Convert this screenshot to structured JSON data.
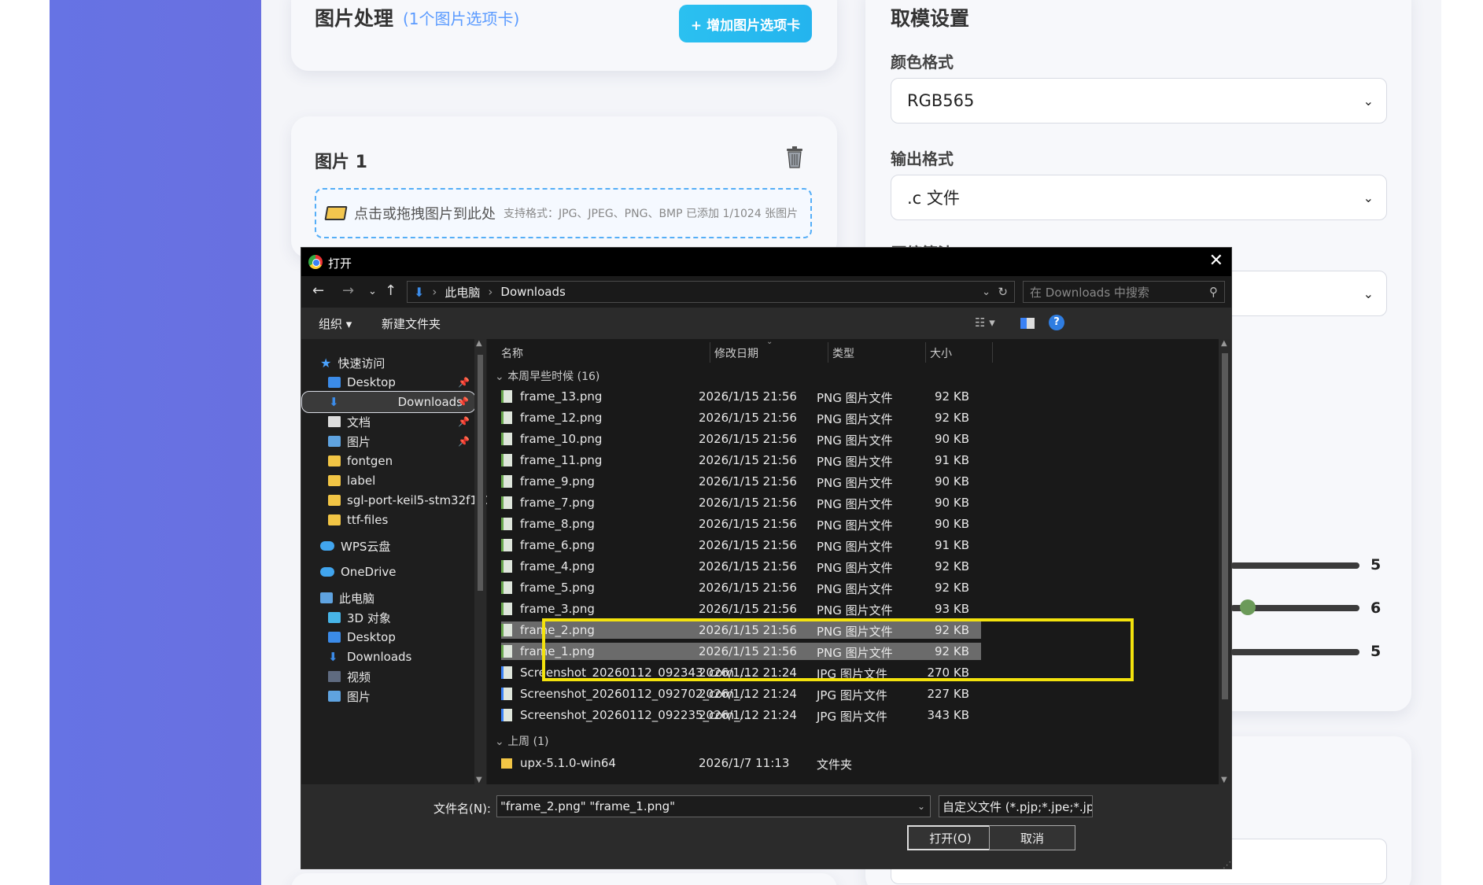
{
  "page": {
    "image_section_title": "图片处理",
    "image_section_sub": "(1个图片选项卡)",
    "add_tab_label": "+ 增加图片选项卡",
    "image_card_title": "图片 1",
    "drop_text": "点击或拖拽图片到此处",
    "drop_hint": "支持格式：JPG、JPEG、PNG、BMP 已添加 1/1024 张图片",
    "settings_title": "取模设置",
    "color_format_label": "颜色格式",
    "color_format_value": "RGB565",
    "output_format_label": "输出格式",
    "output_format_value": ".c 文件",
    "third_label": "压缩算法",
    "slider_values": [
      "5",
      "6",
      "5"
    ]
  },
  "dialog": {
    "title": "打开",
    "breadcrumb": [
      "此电脑",
      "Downloads"
    ],
    "search_placeholder": "在 Downloads 中搜索",
    "organize": "组织 ▾",
    "new_folder": "新建文件夹",
    "nav": {
      "quick_access": "快速访问",
      "items": [
        {
          "label": "Desktop",
          "icon": "desktop-icon"
        },
        {
          "label": "Downloads",
          "icon": "download-icon"
        },
        {
          "label": "文档",
          "icon": "document-icon"
        },
        {
          "label": "图片",
          "icon": "picture-icon"
        },
        {
          "label": "fontgen",
          "icon": "folder-icon"
        },
        {
          "label": "label",
          "icon": "folder-icon"
        },
        {
          "label": "sgl-port-keil5-stm32f103",
          "icon": "folder-icon"
        },
        {
          "label": "ttf-files",
          "icon": "folder-icon"
        }
      ],
      "wps": "WPS云盘",
      "onedrive": "OneDrive",
      "this_pc": "此电脑",
      "pc_items": [
        {
          "label": "3D 对象",
          "icon": "3d-objects-icon"
        },
        {
          "label": "Desktop",
          "icon": "desktop-icon"
        },
        {
          "label": "Downloads",
          "icon": "download-icon"
        },
        {
          "label": "视频",
          "icon": "video-icon"
        },
        {
          "label": "图片",
          "icon": "picture-icon"
        }
      ]
    },
    "columns": {
      "name": "名称",
      "date": "修改日期",
      "type": "类型",
      "size": "大小"
    },
    "group1": "本周早些时候 (16)",
    "files": [
      {
        "name": "frame_13.png",
        "date": "2026/1/15 21:56",
        "type": "PNG 图片文件",
        "size": "92 KB"
      },
      {
        "name": "frame_12.png",
        "date": "2026/1/15 21:56",
        "type": "PNG 图片文件",
        "size": "92 KB"
      },
      {
        "name": "frame_10.png",
        "date": "2026/1/15 21:56",
        "type": "PNG 图片文件",
        "size": "90 KB"
      },
      {
        "name": "frame_11.png",
        "date": "2026/1/15 21:56",
        "type": "PNG 图片文件",
        "size": "91 KB"
      },
      {
        "name": "frame_9.png",
        "date": "2026/1/15 21:56",
        "type": "PNG 图片文件",
        "size": "90 KB"
      },
      {
        "name": "frame_7.png",
        "date": "2026/1/15 21:56",
        "type": "PNG 图片文件",
        "size": "90 KB"
      },
      {
        "name": "frame_8.png",
        "date": "2026/1/15 21:56",
        "type": "PNG 图片文件",
        "size": "90 KB"
      },
      {
        "name": "frame_6.png",
        "date": "2026/1/15 21:56",
        "type": "PNG 图片文件",
        "size": "91 KB"
      },
      {
        "name": "frame_4.png",
        "date": "2026/1/15 21:56",
        "type": "PNG 图片文件",
        "size": "92 KB"
      },
      {
        "name": "frame_5.png",
        "date": "2026/1/15 21:56",
        "type": "PNG 图片文件",
        "size": "92 KB"
      },
      {
        "name": "frame_3.png",
        "date": "2026/1/15 21:56",
        "type": "PNG 图片文件",
        "size": "93 KB"
      },
      {
        "name": "frame_2.png",
        "date": "2026/1/15 21:56",
        "type": "PNG 图片文件",
        "size": "92 KB"
      },
      {
        "name": "frame_1.png",
        "date": "2026/1/15 21:56",
        "type": "PNG 图片文件",
        "size": "92 KB"
      },
      {
        "name": "Screenshot_20260112_092343_com_...",
        "date": "2026/1/12 21:24",
        "type": "JPG 图片文件",
        "size": "270 KB"
      },
      {
        "name": "Screenshot_20260112_092702_com_...",
        "date": "2026/1/12 21:24",
        "type": "JPG 图片文件",
        "size": "227 KB"
      },
      {
        "name": "Screenshot_20260112_092235_com_...",
        "date": "2026/1/12 21:24",
        "type": "JPG 图片文件",
        "size": "343 KB"
      }
    ],
    "group2": "上周 (1)",
    "folder_row": {
      "name": "upx-5.1.0-win64",
      "date": "2026/1/7 11:13",
      "type": "文件夹"
    },
    "filename_label": "文件名(N):",
    "filename_value": "\"frame_2.png\" \"frame_1.png\"",
    "filetype_value": "自定义文件 (*.pjp;*.jpe;*.jpeg;",
    "open_button": "打开(O)",
    "cancel_button": "取消"
  }
}
